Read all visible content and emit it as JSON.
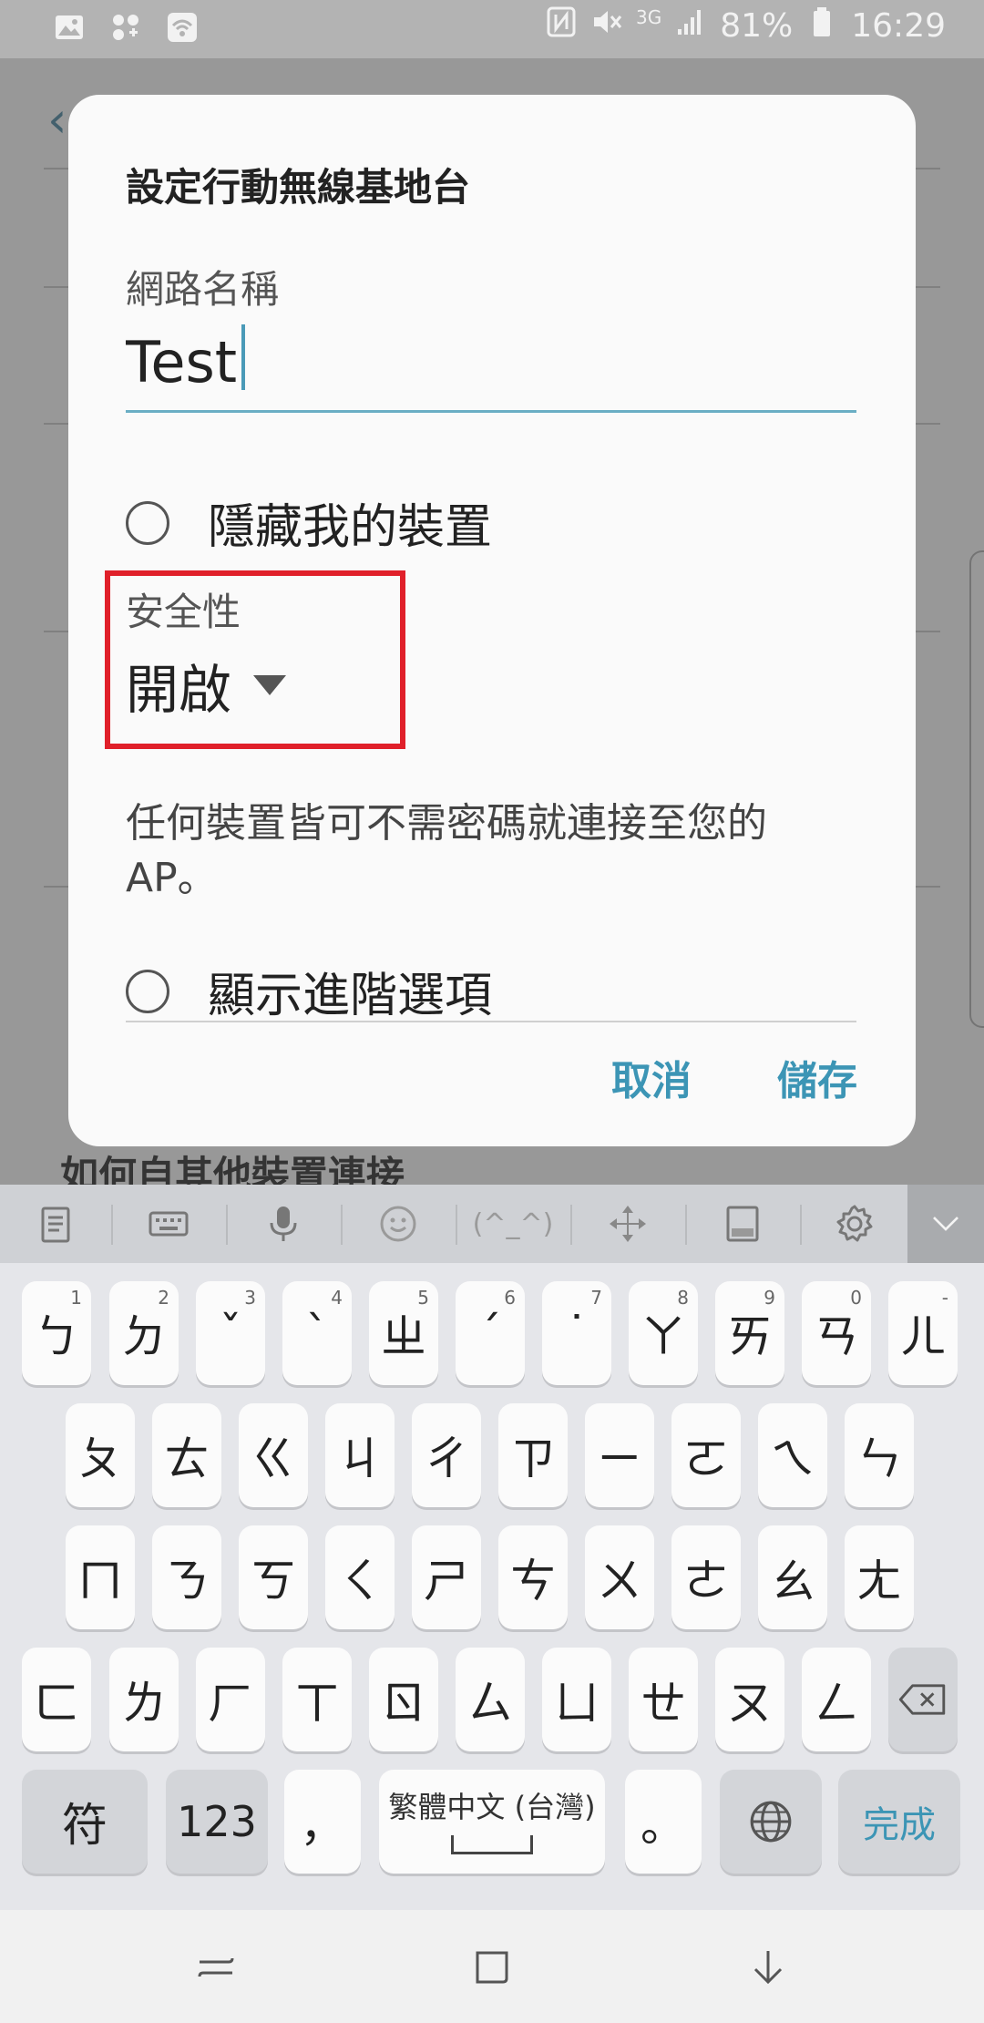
{
  "status_bar": {
    "battery_percent": "81%",
    "time": "16:29",
    "network_type": "3G"
  },
  "background": {
    "section_heading": "如何自其他裝置連接"
  },
  "dialog": {
    "title": "設定行動無線基地台",
    "network_name_label": "網路名稱",
    "network_name_value": "Test",
    "hide_device_label": "隱藏我的裝置",
    "security_label": "安全性",
    "security_value": "開啟",
    "security_description": "任何裝置皆可不需密碼就連接至您的AP。",
    "advanced_label": "顯示進階選項",
    "cancel_label": "取消",
    "save_label": "儲存",
    "accent_color": "#3c95b5",
    "highlight_color": "#e0202a"
  },
  "keyboard": {
    "toolbar_emoticon": "(^_^)",
    "row1": [
      {
        "label": "ㄅ",
        "hint": "1"
      },
      {
        "label": "ㄉ",
        "hint": "2"
      },
      {
        "label": "ˇ",
        "hint": "3"
      },
      {
        "label": "ˋ",
        "hint": "4"
      },
      {
        "label": "ㄓ",
        "hint": "5"
      },
      {
        "label": "ˊ",
        "hint": "6"
      },
      {
        "label": "˙",
        "hint": "7"
      },
      {
        "label": "ㄚ",
        "hint": "8"
      },
      {
        "label": "ㄞ",
        "hint": "9"
      },
      {
        "label": "ㄢ",
        "hint": "0"
      },
      {
        "label": "ㄦ",
        "hint": "-"
      }
    ],
    "row2": [
      "ㄆ",
      "ㄊ",
      "ㄍ",
      "ㄐ",
      "ㄔ",
      "ㄗ",
      "ㄧ",
      "ㄛ",
      "ㄟ",
      "ㄣ"
    ],
    "row3": [
      "ㄇ",
      "ㄋ",
      "ㄎ",
      "ㄑ",
      "ㄕ",
      "ㄘ",
      "ㄨ",
      "ㄜ",
      "ㄠ",
      "ㄤ"
    ],
    "row4": [
      "ㄈ",
      "ㄌ",
      "ㄏ",
      "ㄒ",
      "ㄖ",
      "ㄙ",
      "ㄩ",
      "ㄝ",
      "ㄡ",
      "ㄥ"
    ],
    "symbol_key": "符",
    "number_key": "123",
    "comma_key": "，",
    "space_label": "繁體中文 (台灣)",
    "period_key": "。",
    "done_key": "完成"
  }
}
